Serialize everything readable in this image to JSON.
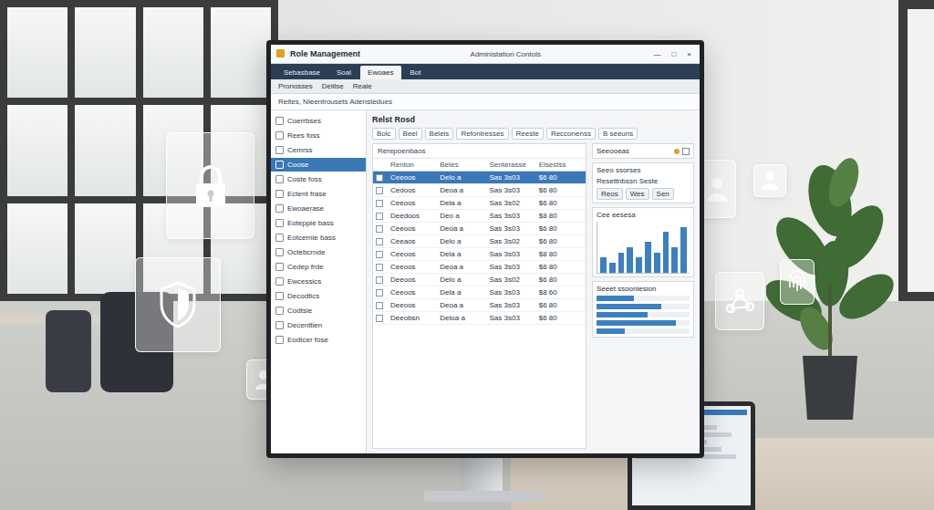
{
  "window": {
    "title": "Role Management",
    "subtitle": "Administation Contols",
    "controls": [
      "—",
      "□",
      "×"
    ]
  },
  "tabs": [
    {
      "label": "Sebasbase",
      "selected": false
    },
    {
      "label": "Soal",
      "selected": false
    },
    {
      "label": "Ewoaes",
      "selected": true
    },
    {
      "label": "Bot",
      "selected": false
    }
  ],
  "subtabs": [
    "Pronosses",
    "Deiilse",
    "Reale"
  ],
  "breadcrumb": "Reites, Nleentrousets Adenstedues",
  "sidebar": {
    "items": [
      {
        "label": "Coerrbses",
        "selected": false
      },
      {
        "label": "Rees foss",
        "selected": false
      },
      {
        "label": "Cemrss",
        "selected": false
      },
      {
        "label": "Coose",
        "selected": true
      },
      {
        "label": "Coste foss",
        "selected": false
      },
      {
        "label": "Ectent frase",
        "selected": false
      },
      {
        "label": "Ewoaerase",
        "selected": false
      },
      {
        "label": "Eoteppie bass",
        "selected": false
      },
      {
        "label": "Eotcernie bass",
        "selected": false
      },
      {
        "label": "Octebcrnde",
        "selected": false
      },
      {
        "label": "Cedep frde",
        "selected": false
      },
      {
        "label": "Ewcessics",
        "selected": false
      },
      {
        "label": "Decodtics",
        "selected": false
      },
      {
        "label": "Codtsie",
        "selected": false
      },
      {
        "label": "Decenttien",
        "selected": false
      },
      {
        "label": "Eodtcer fose",
        "selected": false
      }
    ]
  },
  "main": {
    "title": "Relst Rosd",
    "chips": [
      "Bolc",
      "Beel",
      "Beleis",
      "Refontresses",
      "Reeste",
      "Recconenss",
      "B seeuns"
    ],
    "section": "Rerepoenbaos"
  },
  "table": {
    "columns": [
      "Renton",
      "Betes",
      "Senterasse",
      "Elsestss"
    ],
    "rows": [
      {
        "cells": [
          "Ceeoos",
          "Delo a",
          "Sas 3s03",
          "$6 80"
        ],
        "selected": true
      },
      {
        "cells": [
          "Cedoos",
          "Deoa a",
          "Sas 3s03",
          "$6 80"
        ],
        "selected": false
      },
      {
        "cells": [
          "Ceeoos",
          "Dela a",
          "Sas 3s02",
          "$6 80"
        ],
        "selected": false
      },
      {
        "cells": [
          "Deedoos",
          "Deo a",
          "Sas 3s03",
          "$8 80"
        ],
        "selected": false
      },
      {
        "cells": [
          "Ceeoos",
          "Deoa a",
          "Sas 3s03",
          "$6 80"
        ],
        "selected": false
      },
      {
        "cells": [
          "Ceeaos",
          "Delo a",
          "Sas 3s02",
          "$6 80"
        ],
        "selected": false
      },
      {
        "cells": [
          "Ceeoos",
          "Dela a",
          "Sas 3s03",
          "$8 80"
        ],
        "selected": false
      },
      {
        "cells": [
          "Ceeoos",
          "Deoa a",
          "Sas 3s03",
          "$6 80"
        ],
        "selected": false
      },
      {
        "cells": [
          "Deeoos",
          "Delo a",
          "Sas 3s02",
          "$6 80"
        ],
        "selected": false
      },
      {
        "cells": [
          "Ceeoos",
          "Dela a",
          "Sas 3s03",
          "$8 60"
        ],
        "selected": false
      },
      {
        "cells": [
          "Deeoos",
          "Deoa a",
          "Sas 3s03",
          "$6 80"
        ],
        "selected": false
      },
      {
        "cells": [
          "Deeobsn",
          "Deloa a",
          "Sas 3s03",
          "$6 80"
        ],
        "selected": false
      }
    ]
  },
  "side_panel": {
    "header": "Seeooeas",
    "label": "Seeo ssorses",
    "sublabel": "Resettnbssn Seste",
    "buttons": [
      "Reos",
      "Wes",
      "Sen"
    ],
    "chart": {
      "title": "Cee eesesa",
      "max": 10,
      "values": [
        3,
        2,
        4,
        5,
        3,
        6,
        4,
        8,
        5,
        9
      ]
    },
    "hchart": {
      "title": "Seeet ssoonlesion",
      "max": 100,
      "values": [
        40,
        70,
        55,
        85,
        30
      ]
    }
  }
}
